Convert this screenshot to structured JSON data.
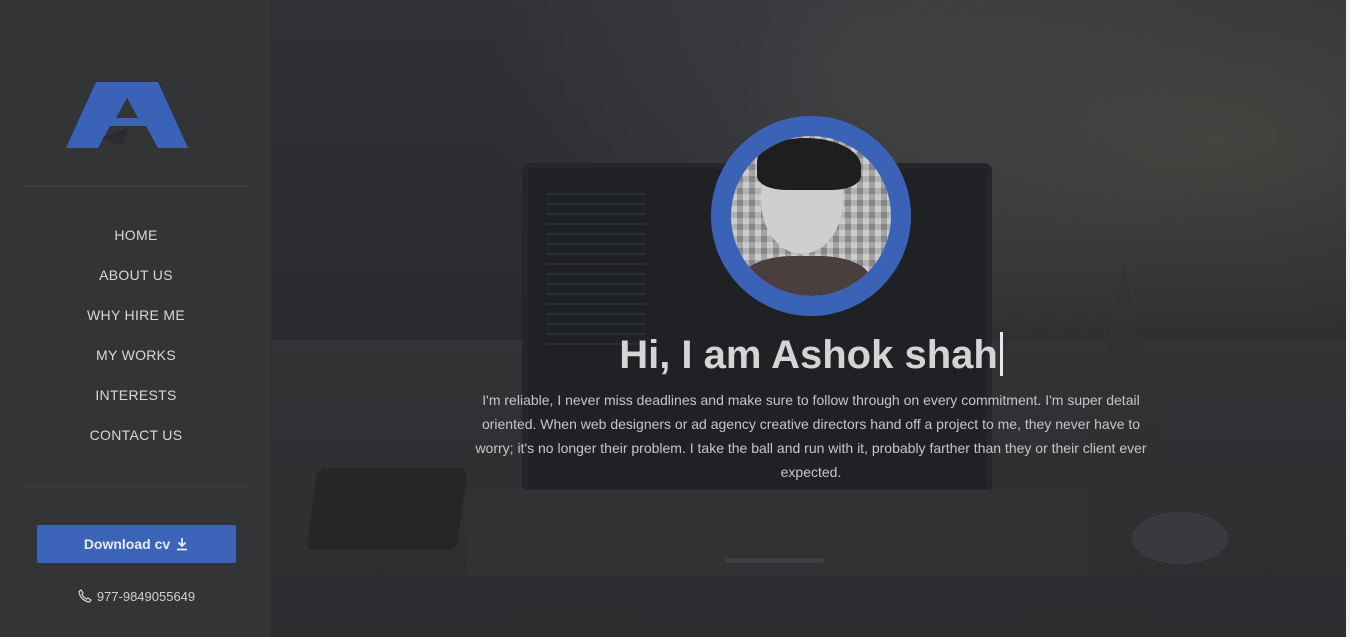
{
  "sidebar": {
    "nav": [
      {
        "label": "HOME"
      },
      {
        "label": "ABOUT US"
      },
      {
        "label": "WHY HIRE ME"
      },
      {
        "label": "MY WORKS"
      },
      {
        "label": "INTERESTS"
      },
      {
        "label": "CONTACT US"
      }
    ],
    "download_label": "Download cv",
    "download_icon": "download-icon",
    "phone_icon": "phone-icon",
    "phone": "977-9849055649"
  },
  "hero": {
    "headline": "Hi, I am Ashok shah",
    "bio": "I'm reliable, I never miss deadlines and make sure to follow through on every commitment. I'm super detail oriented. When web designers or ad agency creative directors hand off a project to me, they never have to worry; it's no longer their problem. I take the ball and run with it, probably farther than they or their client ever expected."
  },
  "colors": {
    "accent": "#3b63b7",
    "sidebar_bg": "#333436",
    "text_light": "#d4d4d4"
  }
}
